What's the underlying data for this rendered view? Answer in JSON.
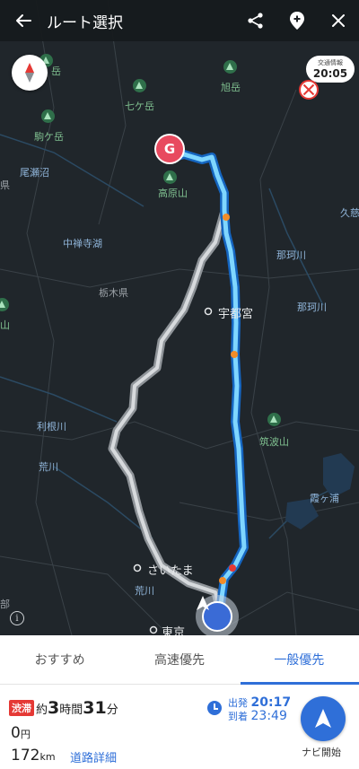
{
  "topbar": {
    "title": "ルート選択"
  },
  "traffic": {
    "label": "交通情報",
    "time": "20:05"
  },
  "goal_marker": "G",
  "map_labels": {
    "asahidake_top": "旭岳",
    "dake_left": "岳",
    "nanatsu": "七ケ岳",
    "komaga": "駒ケ岳",
    "asahidake": "旭岳",
    "ozenuma": "尾瀬沼",
    "takahara": "高原山",
    "chuzenji": "中禅寺湖",
    "tochigi": "栃木県",
    "nakagawa1": "那珂川",
    "nakagawa2": "那珂川",
    "kuji": "久慈",
    "utsunomiya": "宇都宮",
    "yama": "山",
    "ken": "県",
    "tsukuba": "筑波山",
    "tone": "利根川",
    "ara1": "荒川",
    "ara2": "荒川",
    "kasumi": "霞ヶ浦",
    "saitama": "さいたま",
    "tokyo": "東京",
    "bu": "部"
  },
  "tabs": [
    "おすすめ",
    "高速優先",
    "一般優先"
  ],
  "active_tab": 2,
  "summary": {
    "jam_badge": "渋滞",
    "duration_prefix": "約",
    "hours": "3",
    "hours_unit": "時間",
    "minutes": "31",
    "minutes_unit": "分",
    "cost": "0",
    "cost_unit": "円",
    "distance": "172",
    "distance_unit": "km",
    "detail_link": "道路詳細",
    "depart_label": "出発",
    "depart_time": "20:17",
    "arrive_label": "到着",
    "arrive_time": "23:49",
    "nav_label": "ナビ開始"
  },
  "colors": {
    "accent": "#2f6fd8",
    "route_active": "#5ec8ff",
    "route_alt": "#bfc3c7",
    "goal": "#e84a5f",
    "jam": "#e53935"
  }
}
